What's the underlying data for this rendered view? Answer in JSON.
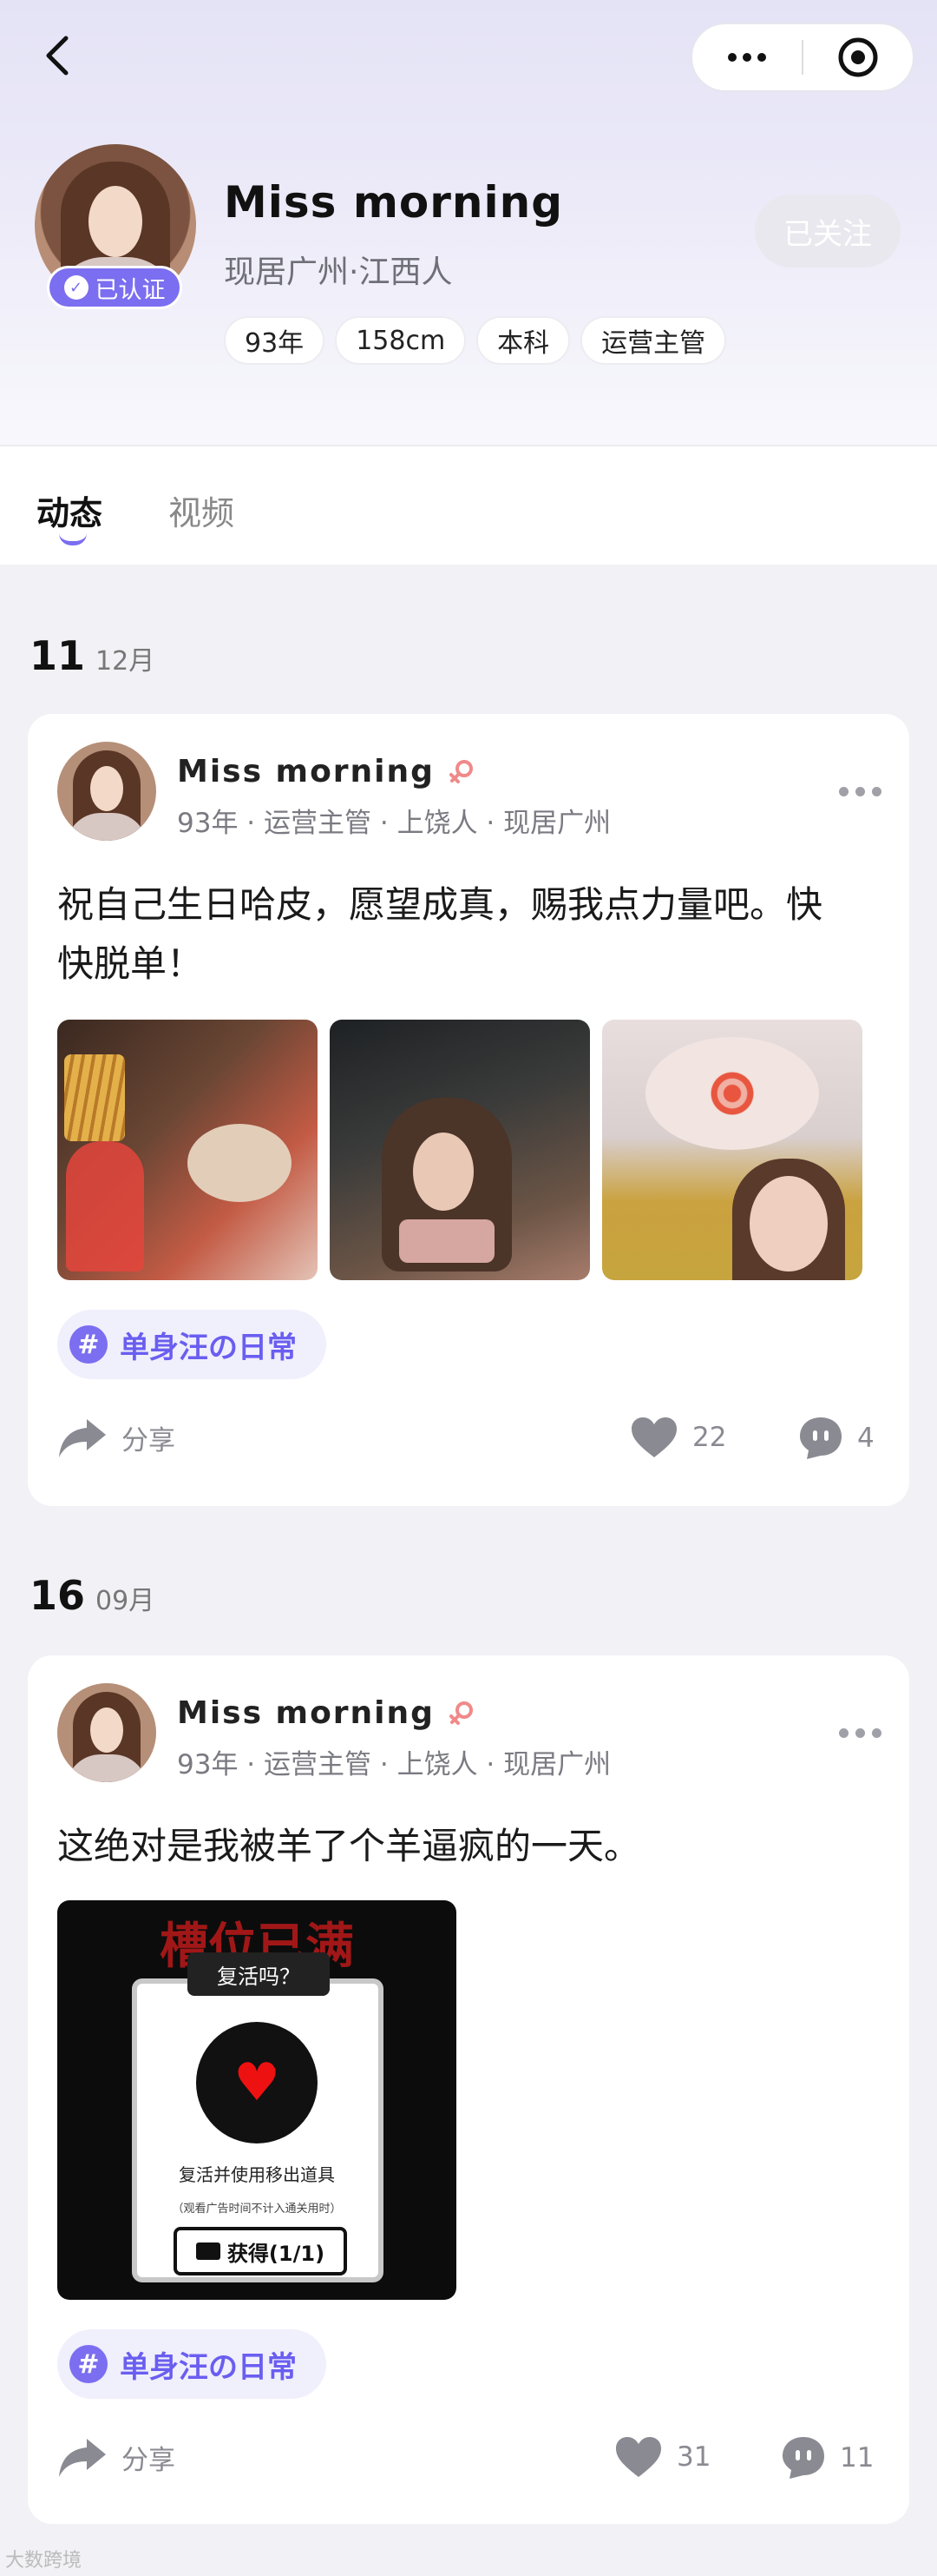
{
  "profile": {
    "name": "Miss morning",
    "location": "现居广州·江西人",
    "verified_label": "已认证",
    "follow_label": "已关注",
    "tags": [
      "93年",
      "158cm",
      "本科",
      "运营主管"
    ]
  },
  "tabs": [
    {
      "label": "动态",
      "active": true
    },
    {
      "label": "视频",
      "active": false
    }
  ],
  "posts": [
    {
      "day": "11",
      "month": "12月",
      "author": "Miss morning",
      "meta": "93年 · 运营主管 · 上饶人 · 现居广州",
      "text": "祝自己生日哈皮，愿望成真，赐我点力量吧。快快脱单！",
      "topic": "单身汪の日常",
      "share_label": "分享",
      "likes": "22",
      "comments": "4"
    },
    {
      "day": "16",
      "month": "09月",
      "author": "Miss morning",
      "meta": "93年 · 运营主管 · 上饶人 · 现居广州",
      "text": "这绝对是我被羊了个羊逼疯的一天。",
      "topic": "单身汪の日常",
      "share_label": "分享",
      "likes": "31",
      "comments": "11",
      "image_text": {
        "title": "槽位已满",
        "subtitle": "复活吗？",
        "label": "复活并使用移出道具",
        "note": "（观看广告时间不计入通关用时）",
        "button": "获得(1/1)"
      }
    }
  ],
  "watermark": "大数跨境",
  "colors": {
    "accent": "#7b6ef0",
    "background": "#f1f1f6",
    "muted": "#8a8a92"
  },
  "icons": [
    "back-icon",
    "more-icon",
    "target-icon",
    "verified-icon",
    "female-icon",
    "share-icon",
    "heart-icon",
    "comment-icon",
    "hashtag-icon"
  ]
}
